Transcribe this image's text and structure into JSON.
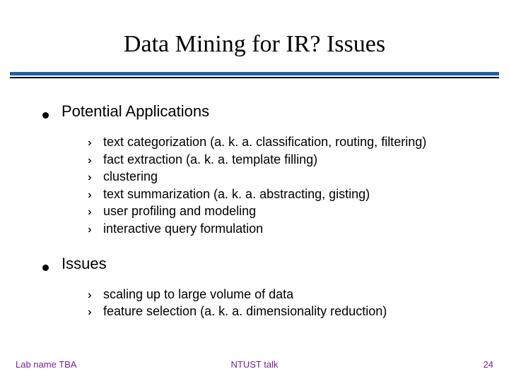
{
  "title": "Data Mining for IR? Issues",
  "sections": [
    {
      "heading": "Potential Applications",
      "items": [
        "text categorization (a. k. a. classification, routing, filtering)",
        "fact extraction (a. k. a. template filling)",
        "clustering",
        "text summarization (a. k. a. abstracting, gisting)",
        "user profiling and modeling",
        "interactive query formulation"
      ]
    },
    {
      "heading": "Issues",
      "items": [
        "scaling up to large volume of data",
        "feature selection (a. k. a. dimensionality reduction)"
      ]
    }
  ],
  "footer": {
    "left": "Lab name TBA",
    "center": "NTUST talk",
    "right": "24"
  }
}
